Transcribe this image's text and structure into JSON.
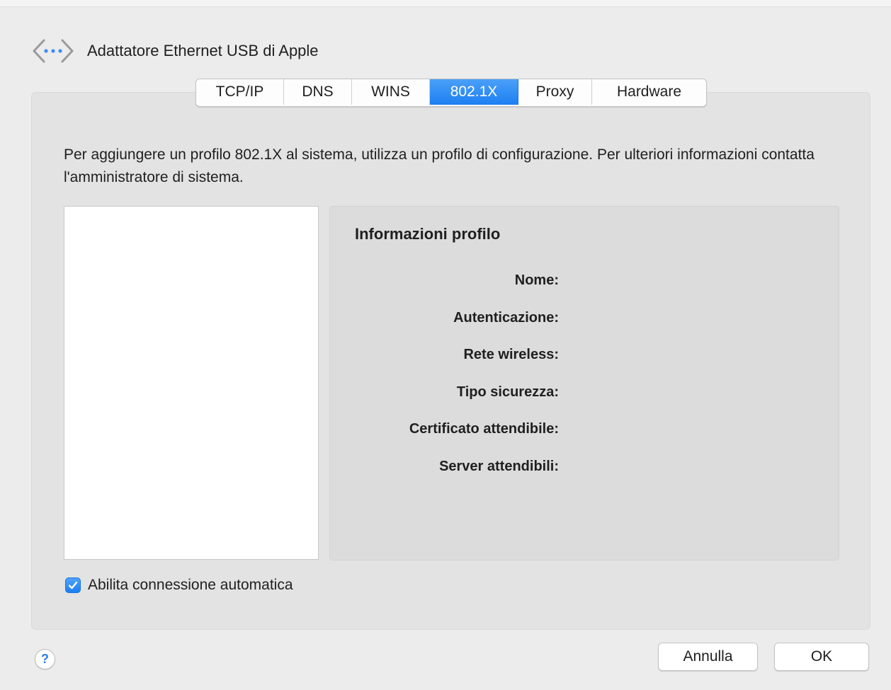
{
  "header": {
    "icon": "network-arrows-icon",
    "title": "Adattatore Ethernet USB di Apple"
  },
  "tabs": [
    {
      "label": "TCP/IP",
      "active": false
    },
    {
      "label": "DNS",
      "active": false
    },
    {
      "label": "WINS",
      "active": false
    },
    {
      "label": "802.1X",
      "active": true
    },
    {
      "label": "Proxy",
      "active": false
    },
    {
      "label": "Hardware",
      "active": false
    }
  ],
  "description": "Per aggiungere un profilo 802.1X al sistema, utilizza un profilo di configurazione. Per ulteriori informazioni contatta l'amministratore di sistema.",
  "profile_list": {
    "items": []
  },
  "info": {
    "title": "Informazioni profilo",
    "labels": [
      "Nome:",
      "Autenticazione:",
      "Rete wireless:",
      "Tipo sicurezza:",
      "Certificato attendibile:",
      "Server attendibili:"
    ]
  },
  "auto_connect": {
    "label": "Abilita connessione automatica",
    "checked": true
  },
  "help": {
    "label": "?",
    "icon": "help-icon"
  },
  "buttons": {
    "cancel": "Annulla",
    "ok": "OK"
  },
  "colors": {
    "accent": "#1d7ff2",
    "background": "#ececec",
    "panel": "#dcdcdc"
  }
}
